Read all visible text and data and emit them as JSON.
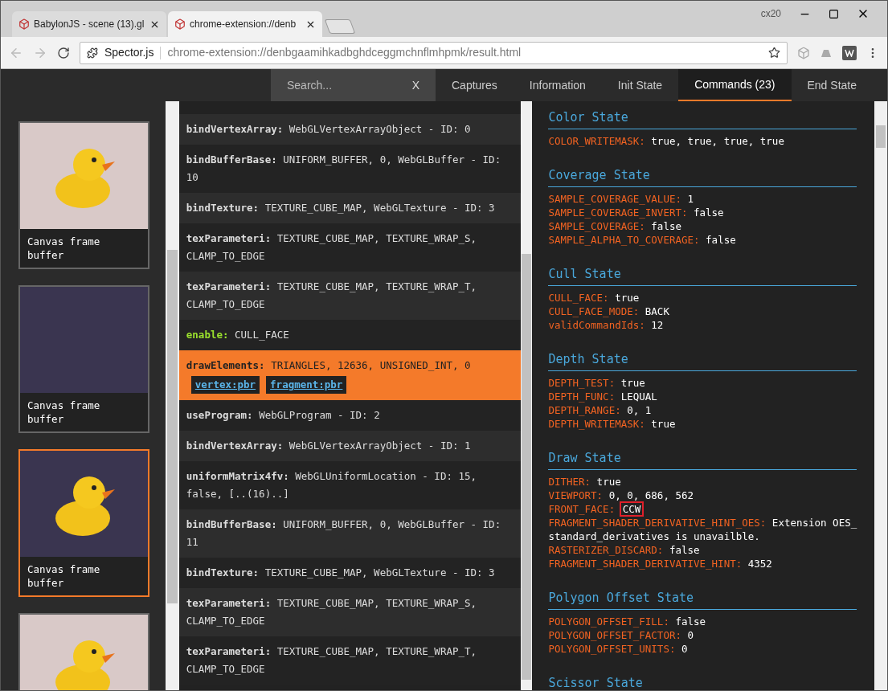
{
  "browser": {
    "tabs": [
      {
        "title": "BabylonJS - scene (13).gl",
        "selected": false
      },
      {
        "title": "chrome-extension://denb",
        "selected": true
      }
    ],
    "profile": "cx20",
    "address": {
      "site": "Spector.js",
      "url": "chrome-extension://denbgaamihkadbghdceggmchnflmhpmk/result.html"
    }
  },
  "nav": {
    "search": {
      "placeholder": "Search..."
    },
    "clear": "X",
    "tabs": [
      {
        "label": "Captures",
        "selected": false
      },
      {
        "label": "Information",
        "selected": false
      },
      {
        "label": "Init State",
        "selected": false
      },
      {
        "label": "Commands (23)",
        "selected": true
      },
      {
        "label": "End State",
        "selected": false
      }
    ]
  },
  "captures": [
    {
      "kind": "duck-light",
      "caption": "Canvas frame buffer",
      "selected": false
    },
    {
      "kind": "empty",
      "caption": "Canvas frame buffer",
      "selected": false
    },
    {
      "kind": "duck-dark",
      "caption": "Canvas frame buffer",
      "selected": true
    },
    {
      "kind": "duck-light",
      "selected": false
    }
  ],
  "commands": [
    {
      "kind": "call",
      "name": "bindVertexArray:",
      "args": "WebGLVertexArrayObject - ID: 0",
      "selected": false
    },
    {
      "kind": "call",
      "name": "bindBufferBase:",
      "args": "UNIFORM_BUFFER, 0, WebGLBuffer - ID: 10",
      "selected": false
    },
    {
      "kind": "call",
      "name": "bindTexture:",
      "args": "TEXTURE_CUBE_MAP, WebGLTexture - ID: 3",
      "selected": false
    },
    {
      "kind": "call",
      "name": "texParameteri:",
      "args": "TEXTURE_CUBE_MAP, TEXTURE_WRAP_S, CLAMP_TO_EDGE",
      "selected": false
    },
    {
      "kind": "call",
      "name": "texParameteri:",
      "args": "TEXTURE_CUBE_MAP, TEXTURE_WRAP_T, CLAMP_TO_EDGE",
      "selected": false
    },
    {
      "kind": "state",
      "name": "enable:",
      "args": "CULL_FACE",
      "selected": false
    },
    {
      "kind": "draw",
      "name": "drawElements:",
      "args": "TRIANGLES, 12636, UNSIGNED_INT, 0",
      "selected": true,
      "shaders": [
        "vertex:pbr",
        "fragment:pbr"
      ]
    },
    {
      "kind": "call",
      "name": "useProgram:",
      "args": "WebGLProgram - ID: 2",
      "selected": false
    },
    {
      "kind": "call",
      "name": "bindVertexArray:",
      "args": "WebGLVertexArrayObject - ID: 1",
      "selected": false
    },
    {
      "kind": "call",
      "name": "uniformMatrix4fv:",
      "args": "WebGLUniformLocation - ID: 15, false, [..(16)..]",
      "selected": false
    },
    {
      "kind": "call",
      "name": "bindBufferBase:",
      "args": "UNIFORM_BUFFER, 0, WebGLBuffer - ID: 11",
      "selected": false
    },
    {
      "kind": "call",
      "name": "bindTexture:",
      "args": "TEXTURE_CUBE_MAP, WebGLTexture - ID: 3",
      "selected": false
    },
    {
      "kind": "call",
      "name": "texParameteri:",
      "args": "TEXTURE_CUBE_MAP, TEXTURE_WRAP_S, CLAMP_TO_EDGE",
      "selected": false
    },
    {
      "kind": "call",
      "name": "texParameteri:",
      "args": "TEXTURE_CUBE_MAP, TEXTURE_WRAP_T, CLAMP_TO_EDGE",
      "selected": false
    }
  ],
  "states": [
    {
      "title": "Color State",
      "entries": [
        {
          "key": "COLOR_WRITEMASK:",
          "value": "true, true, true, true",
          "highlighted": false
        }
      ]
    },
    {
      "title": "Coverage State",
      "entries": [
        {
          "key": "SAMPLE_COVERAGE_VALUE:",
          "value": "1",
          "highlighted": false
        },
        {
          "key": "SAMPLE_COVERAGE_INVERT:",
          "value": "false",
          "highlighted": false
        },
        {
          "key": "SAMPLE_COVERAGE:",
          "value": "false",
          "highlighted": false
        },
        {
          "key": "SAMPLE_ALPHA_TO_COVERAGE:",
          "value": "false",
          "highlighted": false
        }
      ]
    },
    {
      "title": "Cull State",
      "entries": [
        {
          "key": "CULL_FACE:",
          "value": "true",
          "highlighted": false
        },
        {
          "key": "CULL_FACE_MODE:",
          "value": "BACK",
          "highlighted": false
        },
        {
          "key": "validCommandIds:",
          "value": "12",
          "highlighted": false
        }
      ]
    },
    {
      "title": "Depth State",
      "entries": [
        {
          "key": "DEPTH_TEST:",
          "value": "true",
          "highlighted": false
        },
        {
          "key": "DEPTH_FUNC:",
          "value": "LEQUAL",
          "highlighted": false
        },
        {
          "key": "DEPTH_RANGE:",
          "value": "0, 1",
          "highlighted": false
        },
        {
          "key": "DEPTH_WRITEMASK:",
          "value": "true",
          "highlighted": false
        }
      ]
    },
    {
      "title": "Draw State",
      "entries": [
        {
          "key": "DITHER:",
          "value": "true",
          "highlighted": false
        },
        {
          "key": "VIEWPORT:",
          "value": "0, 0, 686, 562",
          "highlighted": false
        },
        {
          "key": "FRONT_FACE:",
          "value": "CCW",
          "highlighted": true
        },
        {
          "key": "FRAGMENT_SHADER_DERIVATIVE_HINT_OES:",
          "value": "Extension OES_standard_derivatives is unavailble.",
          "highlighted": false
        },
        {
          "key": "RASTERIZER_DISCARD:",
          "value": "false",
          "highlighted": false
        },
        {
          "key": "FRAGMENT_SHADER_DERIVATIVE_HINT:",
          "value": "4352",
          "highlighted": false
        }
      ]
    },
    {
      "title": "Polygon Offset State",
      "entries": [
        {
          "key": "POLYGON_OFFSET_FILL:",
          "value": "false",
          "highlighted": false
        },
        {
          "key": "POLYGON_OFFSET_FACTOR:",
          "value": "0",
          "highlighted": false
        },
        {
          "key": "POLYGON_OFFSET_UNITS:",
          "value": "0",
          "highlighted": false
        }
      ]
    },
    {
      "title": "Scissor State"
    }
  ]
}
